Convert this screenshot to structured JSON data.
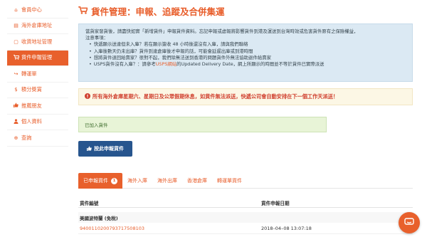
{
  "sidebar": {
    "items": [
      {
        "icon": "home-icon",
        "glyph": "⌂",
        "label": "會員中心",
        "active": false
      },
      {
        "icon": "paste-icon",
        "glyph": "▤",
        "label": "海外倉庫地址",
        "active": false
      },
      {
        "icon": "copy-icon",
        "glyph": "▢",
        "label": "收貨地址管理",
        "active": false
      },
      {
        "icon": "cart-icon",
        "glyph": "",
        "label": "貨件申報管理",
        "active": true
      },
      {
        "icon": "share-icon",
        "glyph": "↪",
        "label": "轉運單",
        "active": false
      },
      {
        "icon": "dollar-icon",
        "glyph": "$",
        "label": "積分獎賞",
        "active": false
      },
      {
        "icon": "thumbs-up-icon",
        "glyph": "",
        "label": "推薦朋友",
        "active": false
      },
      {
        "icon": "user-icon",
        "glyph": "",
        "label": "個人資料",
        "active": false
      },
      {
        "icon": "lifebuoy-icon",
        "glyph": "⊕",
        "label": "查詢",
        "active": false
      }
    ]
  },
  "page": {
    "title": "貨件管理：申報、追蹤及合併集運"
  },
  "info": {
    "intro": "當貨家發貨後，請盡快如實「新增貨件」申報貨件資料。忘記申報或虛報將影響貨件到港及運送到台灣時效或危害貨件原有之保險權益，",
    "note_label": "注意事項：",
    "bullets": [
      "快遞顯示送達但未入庫？若在顯示簽收 48 小時後還沒有入庫，請與我們聯絡",
      "入庫後數天仍未出庫？貨件到達倉庫後才申報的話，可能會延遲出庫或到港時間",
      "想將貨件退回給賣家？很對不起，我們除無法送到香港的問題貨件外無法協助退件給賣家"
    ],
    "usps_pre": "USPS貨件沒有入庫？：請參考",
    "usps_link": "USPS網站",
    "usps_post": "的Updated Delivery Date，網上所顯示的時間並不等於貨件已實際派送"
  },
  "warning": {
    "text": "所有海外倉庫星期六、星期日及公眾假期休息，如貨件無法派送，快遞公司會自動安排在下一個工作天派送！"
  },
  "success": {
    "text": "已加入貨件"
  },
  "actions": {
    "add_label": "按此申報貨件"
  },
  "tabs": [
    {
      "label": "已申報貨件",
      "badge": "1",
      "active": true
    },
    {
      "label": "海外入庫",
      "badge": "",
      "active": false
    },
    {
      "label": "海外出庫",
      "badge": "",
      "active": false
    },
    {
      "label": "香港倉庫",
      "badge": "",
      "active": false
    },
    {
      "label": "轉運單貨件",
      "badge": "",
      "active": false
    }
  ],
  "table": {
    "headers": {
      "tracking": "貨件編號",
      "date": "貨件申報日期"
    },
    "group": "美國波特蘭 (免稅)",
    "rows": [
      {
        "tracking": "9400110200793717508103",
        "date": "2018–04–08 13:07:18"
      }
    ]
  },
  "colors": {
    "accent": "#e8602c",
    "primary_button": "#27558e",
    "info_bg": "#dbe9f3",
    "warning_bg": "#fcf7e5",
    "success_bg": "#e8f4d7"
  }
}
